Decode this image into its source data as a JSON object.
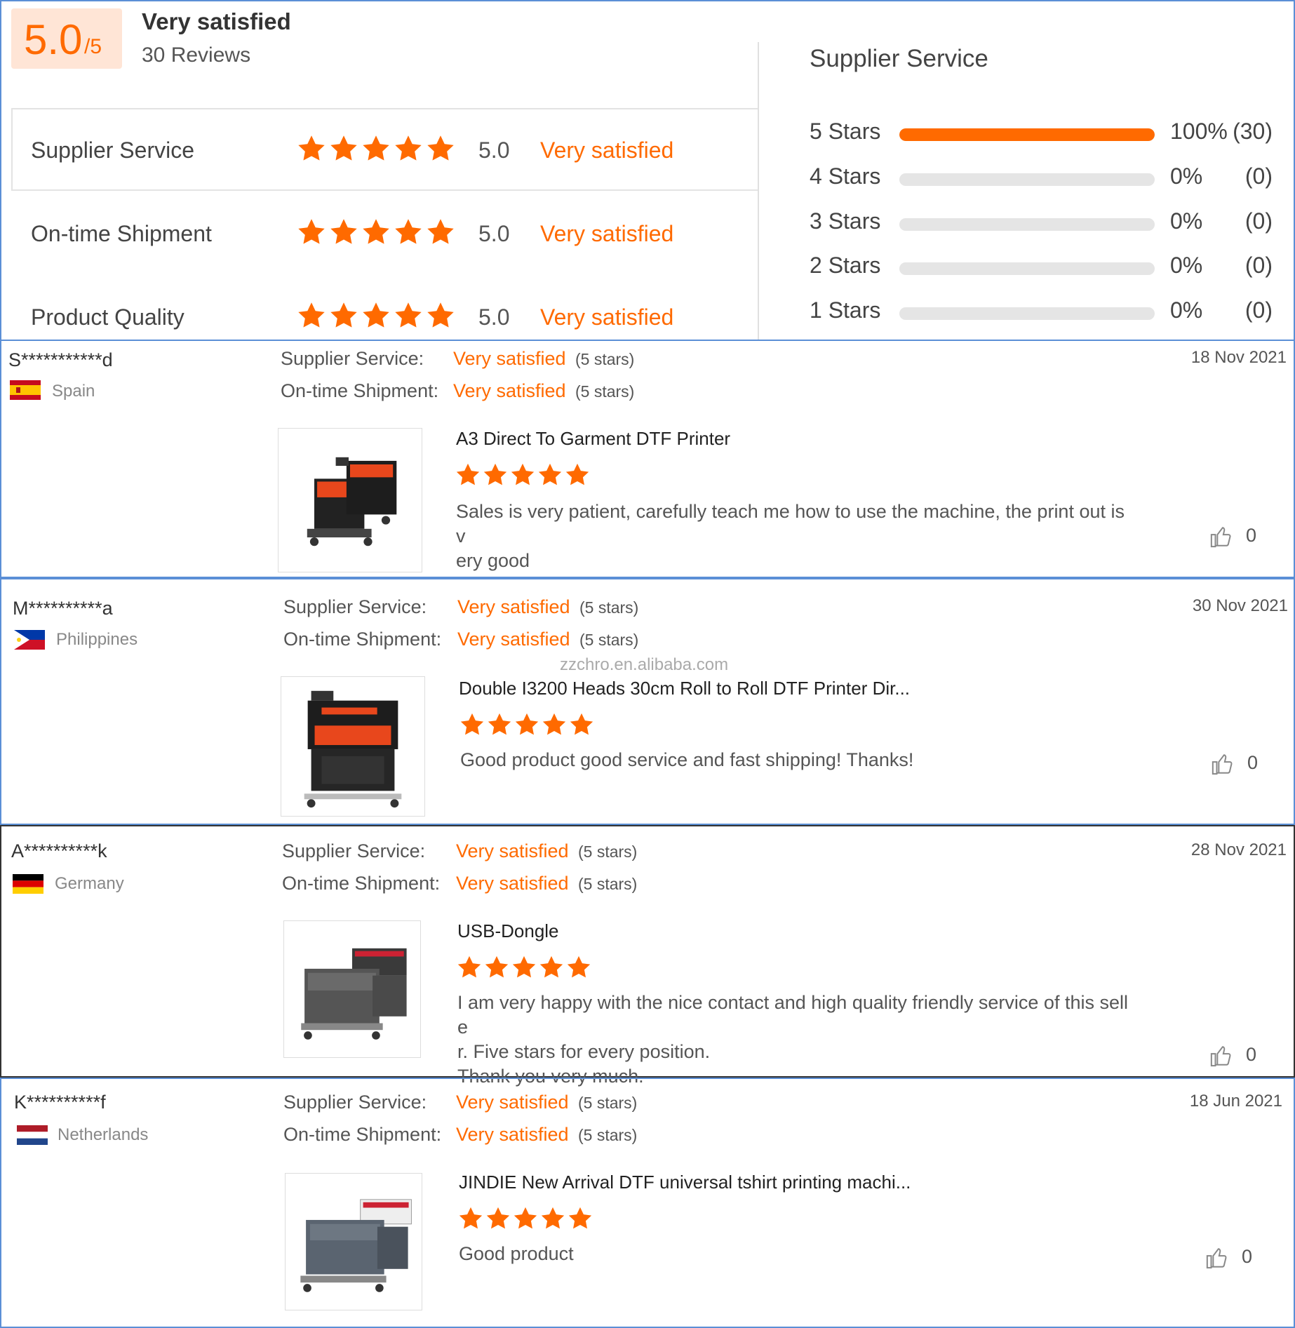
{
  "summary": {
    "score": "5.0",
    "score_max": "/5",
    "title": "Very satisfied",
    "reviews": "30 Reviews",
    "criteria": [
      {
        "label": "Supplier Service",
        "stars": 5,
        "score": "5.0",
        "satisfaction": "Very satisfied"
      },
      {
        "label": "On-time Shipment",
        "stars": 5,
        "score": "5.0",
        "satisfaction": "Very satisfied"
      },
      {
        "label": "Product Quality",
        "stars": 5,
        "score": "5.0",
        "satisfaction": "Very satisfied"
      }
    ]
  },
  "distribution": {
    "title": "Supplier Service",
    "rows": [
      {
        "label": "5 Stars",
        "fraction": 1.0,
        "percent": "100%",
        "count": "(30)"
      },
      {
        "label": "4 Stars",
        "fraction": 0,
        "percent": "0%",
        "count": "(0)"
      },
      {
        "label": "3 Stars",
        "fraction": 0,
        "percent": "0%",
        "count": "(0)"
      },
      {
        "label": "2 Stars",
        "fraction": 0,
        "percent": "0%",
        "count": "(0)"
      },
      {
        "label": "1 Stars",
        "fraction": 0,
        "percent": "0%",
        "count": "(0)"
      }
    ]
  },
  "labels": {
    "supplier_service": "Supplier Service:",
    "ontime_shipment": "On-time Shipment:"
  },
  "reviews": [
    {
      "name": "S***********d",
      "country": "Spain",
      "flag": "spain-flag-icon",
      "date": "18 Nov 2021",
      "supplier_sat": "Very satisfied",
      "supplier_stars": "(5 stars)",
      "shipment_sat": "Very satisfied",
      "shipment_stars": "(5 stars)",
      "product": "A3 Direct To Garment DTF Printer",
      "rating": 5,
      "text": "Sales is very patient, carefully teach me how to use the machine, the print out is v\nery good",
      "likes": "0"
    },
    {
      "name": "M**********a",
      "country": "Philippines",
      "flag": "philippines-flag-icon",
      "date": "30 Nov 2021",
      "supplier_sat": "Very satisfied",
      "supplier_stars": "(5 stars)",
      "shipment_sat": "Very satisfied",
      "shipment_stars": "(5 stars)",
      "product": "Double I3200 Heads 30cm Roll to Roll DTF Printer Dir...",
      "rating": 5,
      "text": "Good product good service and fast shipping! Thanks!",
      "likes": "0"
    },
    {
      "name": "A**********k",
      "country": "Germany",
      "flag": "germany-flag-icon",
      "date": "28 Nov 2021",
      "supplier_sat": "Very satisfied",
      "supplier_stars": "(5 stars)",
      "shipment_sat": "Very satisfied",
      "shipment_stars": "(5 stars)",
      "product": "USB-Dongle",
      "rating": 5,
      "text": "I am very happy with the nice contact and high quality friendly service of this selle\nr. Five stars for every position.\nThank you very much.",
      "likes": "0"
    },
    {
      "name": "K**********f",
      "country": "Netherlands",
      "flag": "netherlands-flag-icon",
      "date": "18 Jun 2021",
      "supplier_sat": "Very satisfied",
      "supplier_stars": "(5 stars)",
      "shipment_sat": "Very satisfied",
      "shipment_stars": "(5 stars)",
      "product": "JINDIE New Arrival DTF universal tshirt printing machi...",
      "rating": 5,
      "text": "Good product",
      "likes": "0"
    }
  ],
  "watermark": "zzchro.en.alibaba.com",
  "colors": {
    "accent": "#ff6a00",
    "border": "#5b8fd6",
    "score_bg": "#ffe5d6"
  }
}
